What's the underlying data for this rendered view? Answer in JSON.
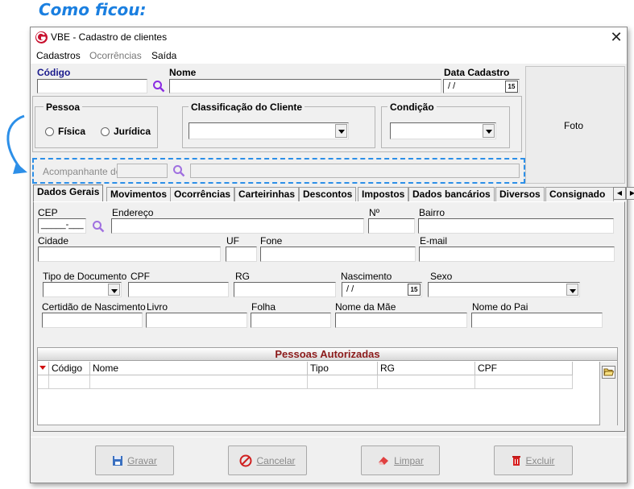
{
  "caption": "Como ficou:",
  "window": {
    "title": "VBE - Cadastro de clientes"
  },
  "menu": {
    "items": [
      "Cadastros",
      "Ocorrências",
      "Saída"
    ]
  },
  "header": {
    "codigo_label": "Código",
    "nome_label": "Nome",
    "data_cadastro_label": "Data Cadastro",
    "data_cadastro_value": " / /",
    "calendar_glyph": "15",
    "foto_label": "Foto"
  },
  "pessoa": {
    "legend": "Pessoa",
    "fisica": "Física",
    "juridica": "Jurídica"
  },
  "classificacao": {
    "legend": "Classificação do Cliente"
  },
  "condicao": {
    "legend": "Condição"
  },
  "acompanhante": {
    "label": "Acompanhante de"
  },
  "tabs": [
    "Dados Gerais",
    "Movimentos",
    "Ocorrências",
    "Carteirinhas",
    "Descontos",
    "Impostos",
    "Dados bancários",
    "Diversos",
    "Consignado"
  ],
  "form": {
    "cep_label": "CEP",
    "cep_value": "_____-___",
    "endereco_label": "Endereço",
    "numero_label": "Nº",
    "bairro_label": "Bairro",
    "cidade_label": "Cidade",
    "uf_label": "UF",
    "fone_label": "Fone",
    "email_label": "E-mail",
    "tipo_doc_label": "Tipo de Documento",
    "cpf_label": "CPF",
    "rg_label": "RG",
    "nascimento_label": "Nascimento",
    "nascimento_value": " / /",
    "sexo_label": "Sexo",
    "certidao_label": "Certidão de Nascimento",
    "livro_label": "Livro",
    "folha_label": "Folha",
    "mae_label": "Nome da Mãe",
    "pai_label": "Nome do Pai"
  },
  "grid": {
    "title": "Pessoas Autorizadas",
    "columns": [
      "Código",
      "Nome",
      "Tipo",
      "RG",
      "CPF"
    ]
  },
  "buttons": {
    "gravar": "Gravar",
    "cancelar": "Cancelar",
    "limpar": "Limpar",
    "excluir": "Excluir"
  },
  "colors": {
    "caption": "#1a7fe0",
    "highlight": "#2c8fe8",
    "grid_title": "#8b1a1a",
    "search_icon": "#8a2be2"
  }
}
